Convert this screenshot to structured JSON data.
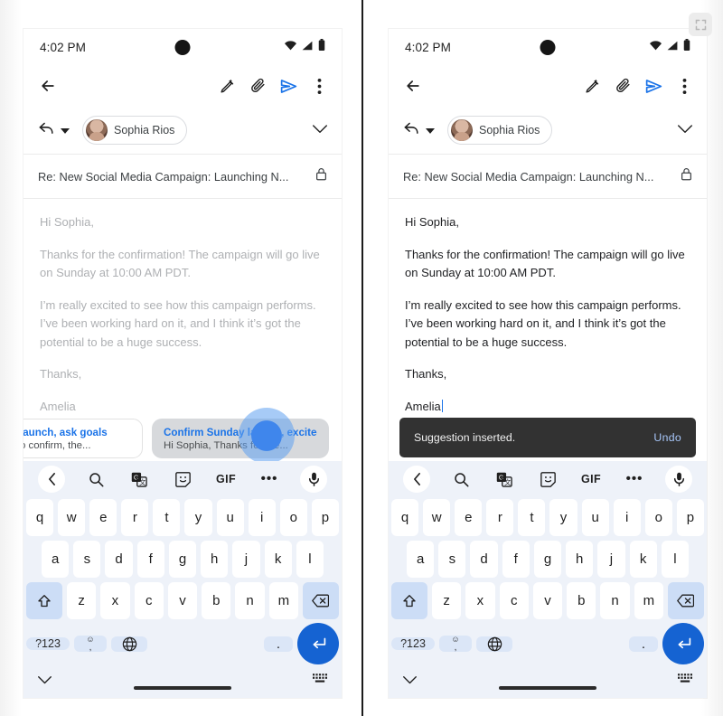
{
  "overlay": {
    "expand_icon": "fullscreen-expand-icon"
  },
  "status_bar": {
    "time": "4:02 PM",
    "icons": [
      "wifi-icon",
      "signal-icon",
      "battery-icon"
    ]
  },
  "app_bar": {
    "back": "back-arrow-icon",
    "actions": [
      "formatting-magic-pen-icon",
      "attach-paperclip-icon",
      "send-icon",
      "overflow-menu-icon"
    ]
  },
  "recipient_row": {
    "reply_icon": "reply-arrow-icon",
    "reply_dropdown": "chevron-down-icon",
    "chip_name": "Sophia Rios",
    "expand": "chevron-down-icon"
  },
  "subject_row": {
    "subject": "Re: New Social Media Campaign: Launching N...",
    "lock": "lock-icon"
  },
  "email_body": {
    "greeting": "Hi Sophia,",
    "paragraph1": "Thanks for the confirmation! The campaign will go live on Sunday at 10:00 AM PDT.",
    "paragraph2": "I’m really excited to see how this campaign performs. I’ve been working hard on it, and I think it’s got the potential to be a huge success.",
    "signoff": "Thanks,",
    "signature": "Amelia"
  },
  "suggestions": {
    "card1": {
      "title": "launch, ask goals",
      "subtitle": "o confirm, the..."
    },
    "card2": {
      "title": "Confirm Sunday launch, excited.",
      "subtitle": "Hi Sophia, Thanks for the..."
    }
  },
  "snackbar": {
    "message": "Suggestion inserted.",
    "action": "Undo"
  },
  "keyboard": {
    "toolbar": [
      "back-chevron-icon",
      "search-icon",
      "translate-icon",
      "sticker-icon",
      "GIF",
      "more-dots-icon",
      "microphone-icon"
    ],
    "gif_label": "GIF",
    "row1": [
      "q",
      "w",
      "e",
      "r",
      "t",
      "y",
      "u",
      "i",
      "o",
      "p"
    ],
    "row2": [
      "a",
      "s",
      "d",
      "f",
      "g",
      "h",
      "j",
      "k",
      "l"
    ],
    "row3": [
      "z",
      "x",
      "c",
      "v",
      "b",
      "n",
      "m"
    ],
    "shift": "shift-icon",
    "backspace": "backspace-icon",
    "symbols_key": "?123",
    "comma_key": ",",
    "comma_emoji": "emoji-icon",
    "globe_key": "globe-language-icon",
    "space_key": " ",
    "period_key": ".",
    "enter_key": "enter-return-icon",
    "hide_keyboard": "chevron-down-icon",
    "keyboard_switch": "keyboard-switch-icon"
  },
  "colors": {
    "accent_blue": "#1a73e8",
    "enter_blue": "#1563d2",
    "snackbar_bg": "#323232",
    "snackbar_action": "#a8c7fa",
    "keyboard_bg": "#eef2f9",
    "mod_key": "#ccddf6"
  }
}
